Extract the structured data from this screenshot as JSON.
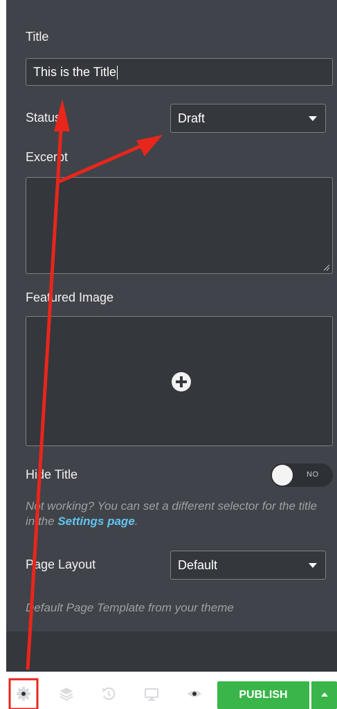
{
  "fields": {
    "title_label": "Title",
    "title_value": "This is the Title",
    "status_label": "Status",
    "status_value": "Draft",
    "excerpt_label": "Excerpt",
    "excerpt_value": "",
    "featured_image_label": "Featured Image",
    "hide_title_label": "Hide Title",
    "hide_title_toggle_text": "NO",
    "hide_title_note_prefix": "Not working? You can set a different selector for the title in the ",
    "hide_title_note_link": "Settings page",
    "hide_title_note_suffix": ".",
    "page_layout_label": "Page Layout",
    "page_layout_value": "Default",
    "page_layout_note": "Default Page Template from your theme"
  },
  "footer": {
    "publish_label": "PUBLISH",
    "icons": [
      "settings-icon",
      "layers-icon",
      "history-icon",
      "responsive-icon",
      "preview-icon"
    ]
  },
  "colors": {
    "panel": "#404349",
    "input": "#34373c",
    "publish": "#39b54a",
    "link": "#62c4ef",
    "annotation": "#e8261c"
  }
}
